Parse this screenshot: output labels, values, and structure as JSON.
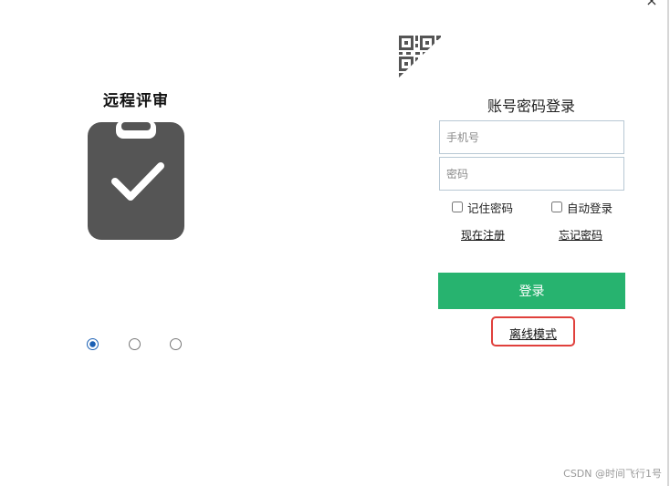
{
  "window": {
    "close_symbol": "×",
    "close_icon": "close-icon"
  },
  "colors": {
    "accent": "#27b36f",
    "highlight": "#e0403c",
    "icon": "#555555",
    "active_dot": "#1a5fb4"
  },
  "left_panel": {
    "app_title": "远程评审",
    "illustration_icon": "clipboard-check-icon",
    "carousel": {
      "slide_count": 3,
      "active_index": 0
    }
  },
  "right_panel": {
    "qr_icon": "qr-code-icon",
    "login_title": "账号密码登录",
    "phone_placeholder": "手机号",
    "phone_value": "",
    "password_placeholder": "密码",
    "password_value": "",
    "remember_label": "记住密码",
    "remember_checked": false,
    "autologin_label": "自动登录",
    "autologin_checked": false,
    "register_link": "现在注册",
    "forgot_link": "忘记密码",
    "login_button": "登录",
    "offline_link": "离线模式"
  },
  "watermark": "CSDN @时间飞行1号"
}
